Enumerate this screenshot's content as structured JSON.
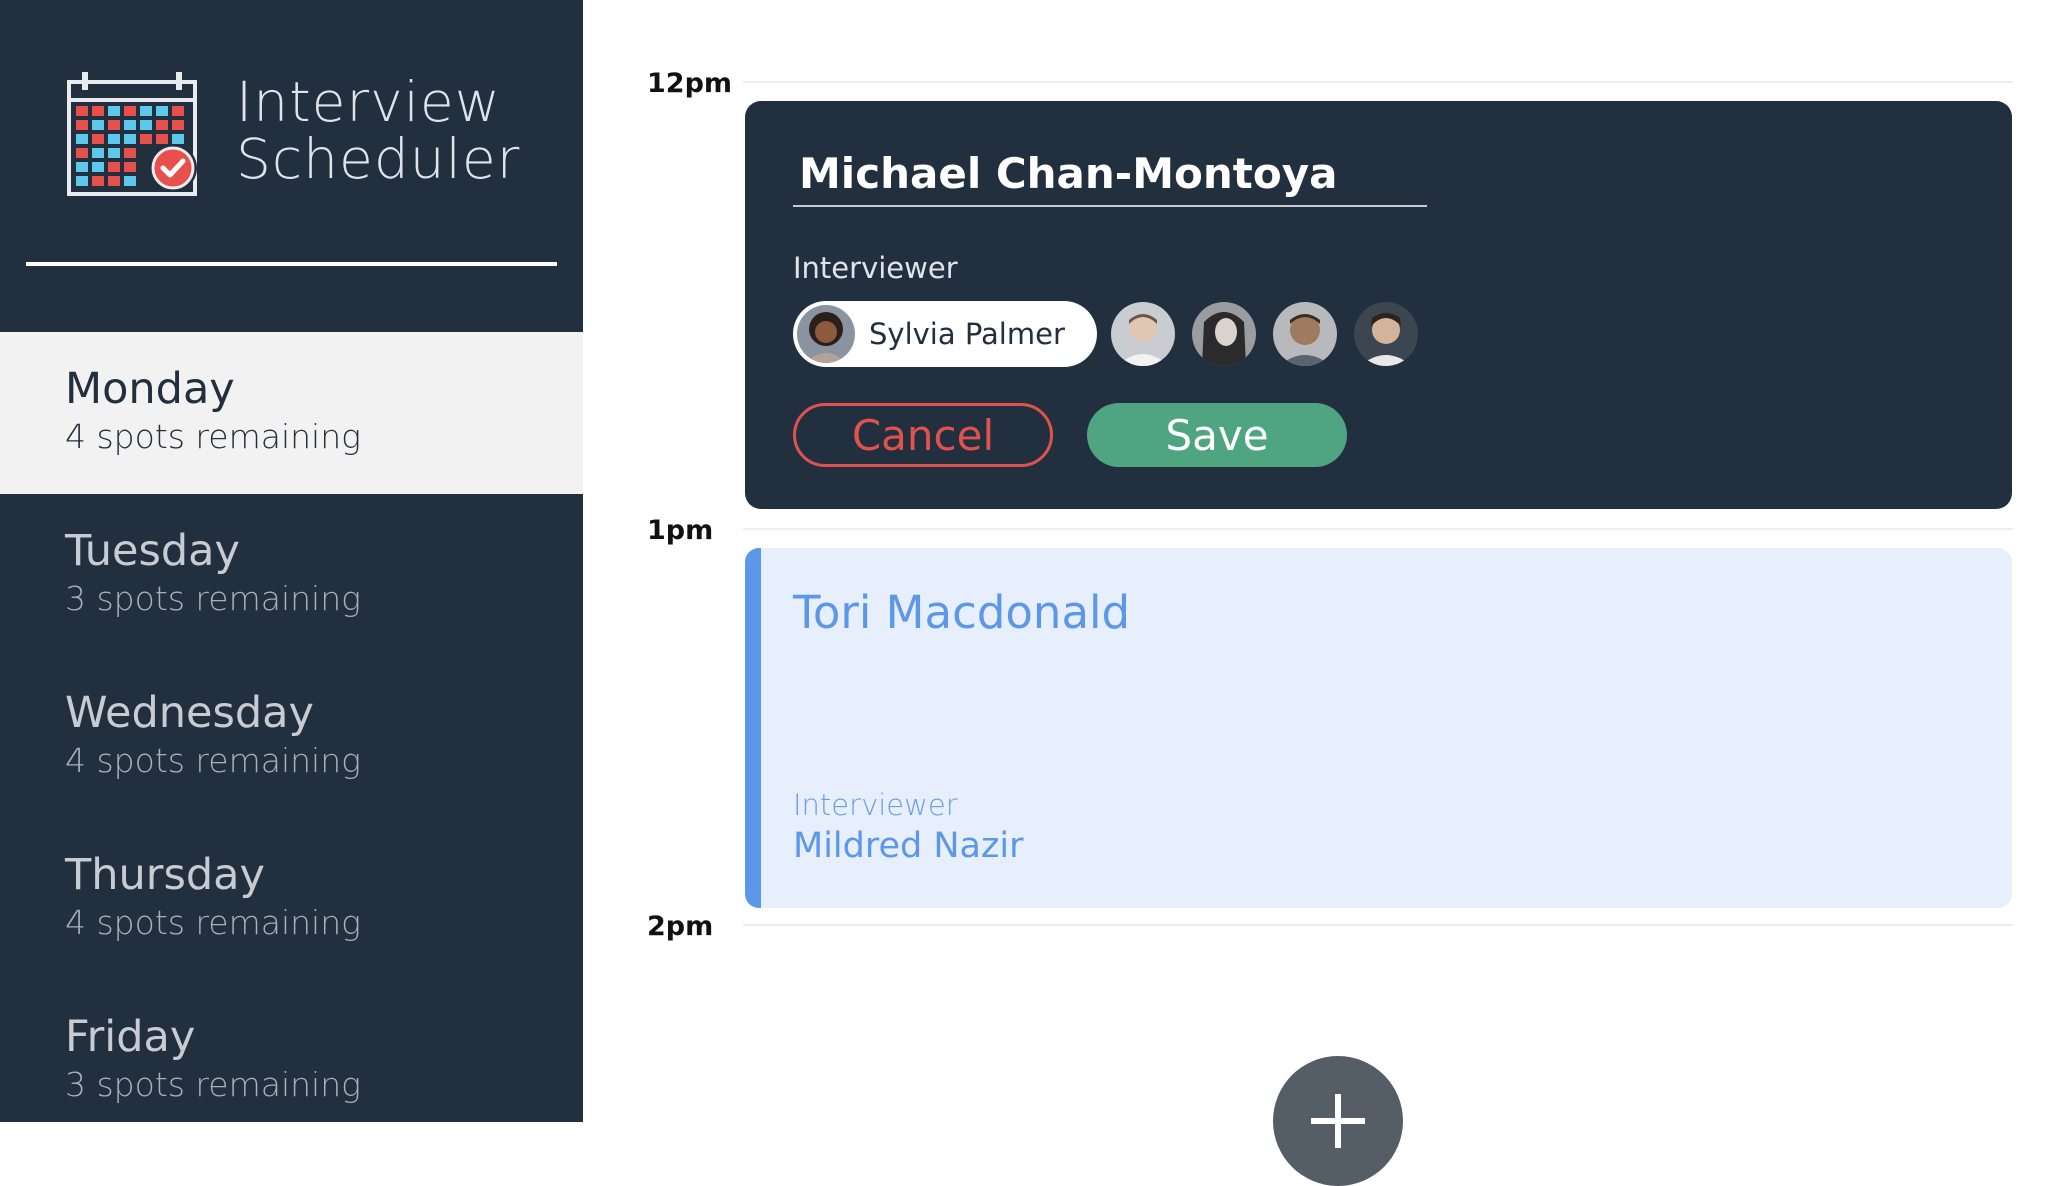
{
  "app": {
    "title_line1": "Interview",
    "title_line2": "Scheduler",
    "logo_icon": "calendar-check-icon"
  },
  "days": [
    {
      "name": "Monday",
      "spots": "4 spots remaining",
      "selected": true
    },
    {
      "name": "Tuesday",
      "spots": "3 spots remaining",
      "selected": false
    },
    {
      "name": "Wednesday",
      "spots": "4 spots remaining",
      "selected": false
    },
    {
      "name": "Thursday",
      "spots": "4 spots remaining",
      "selected": false
    },
    {
      "name": "Friday",
      "spots": "3 spots remaining",
      "selected": false
    }
  ],
  "schedule": {
    "hours": [
      "12pm",
      "1pm",
      "2pm"
    ],
    "edit_form": {
      "student_value": "Michael Chan-Montoya",
      "interviewer_label": "Interviewer",
      "selected_interviewer": "Sylvia Palmer",
      "other_interviewer_avatars": 4,
      "cancel_label": "Cancel",
      "save_label": "Save"
    },
    "appointment": {
      "student": "Tori Macdonald",
      "interviewer_label": "Interviewer",
      "interviewer": "Mildred Nazir"
    },
    "add_icon": "plus-icon"
  },
  "colors": {
    "sidebar": "#222f3e",
    "selected_day": "#f2f2f2",
    "cancel": "#e0524d",
    "save": "#4fa582",
    "appointment_bg": "#e6effb",
    "appointment_accent": "#5c97ea"
  }
}
